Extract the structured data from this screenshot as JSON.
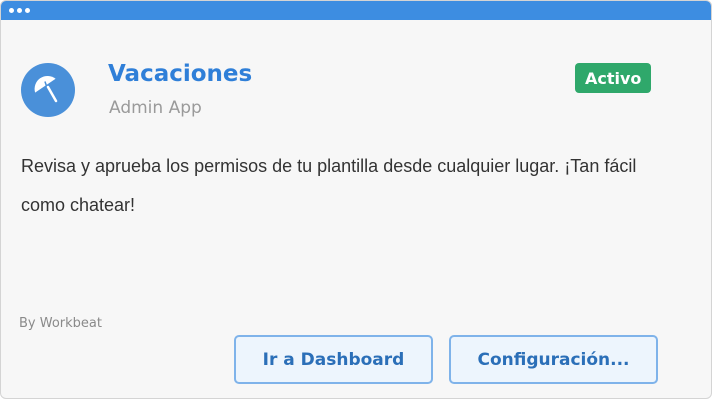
{
  "app": {
    "title": "Vacaciones",
    "subtitle": "Admin App",
    "icon": "beach-umbrella-icon"
  },
  "status": {
    "label": "Activo",
    "color": "#2fa86b"
  },
  "description": "Revisa y aprueba los permisos de tu plantilla desde cualquier lugar. ¡Tan fácil como chatear!",
  "byline": "By Workbeat",
  "buttons": {
    "dashboard_label": "Ir a Dashboard",
    "config_label": "Configuración..."
  },
  "colors": {
    "titlebar": "#3d8de1",
    "accent": "#2f7fd8",
    "icon_background": "#4a90d9"
  }
}
